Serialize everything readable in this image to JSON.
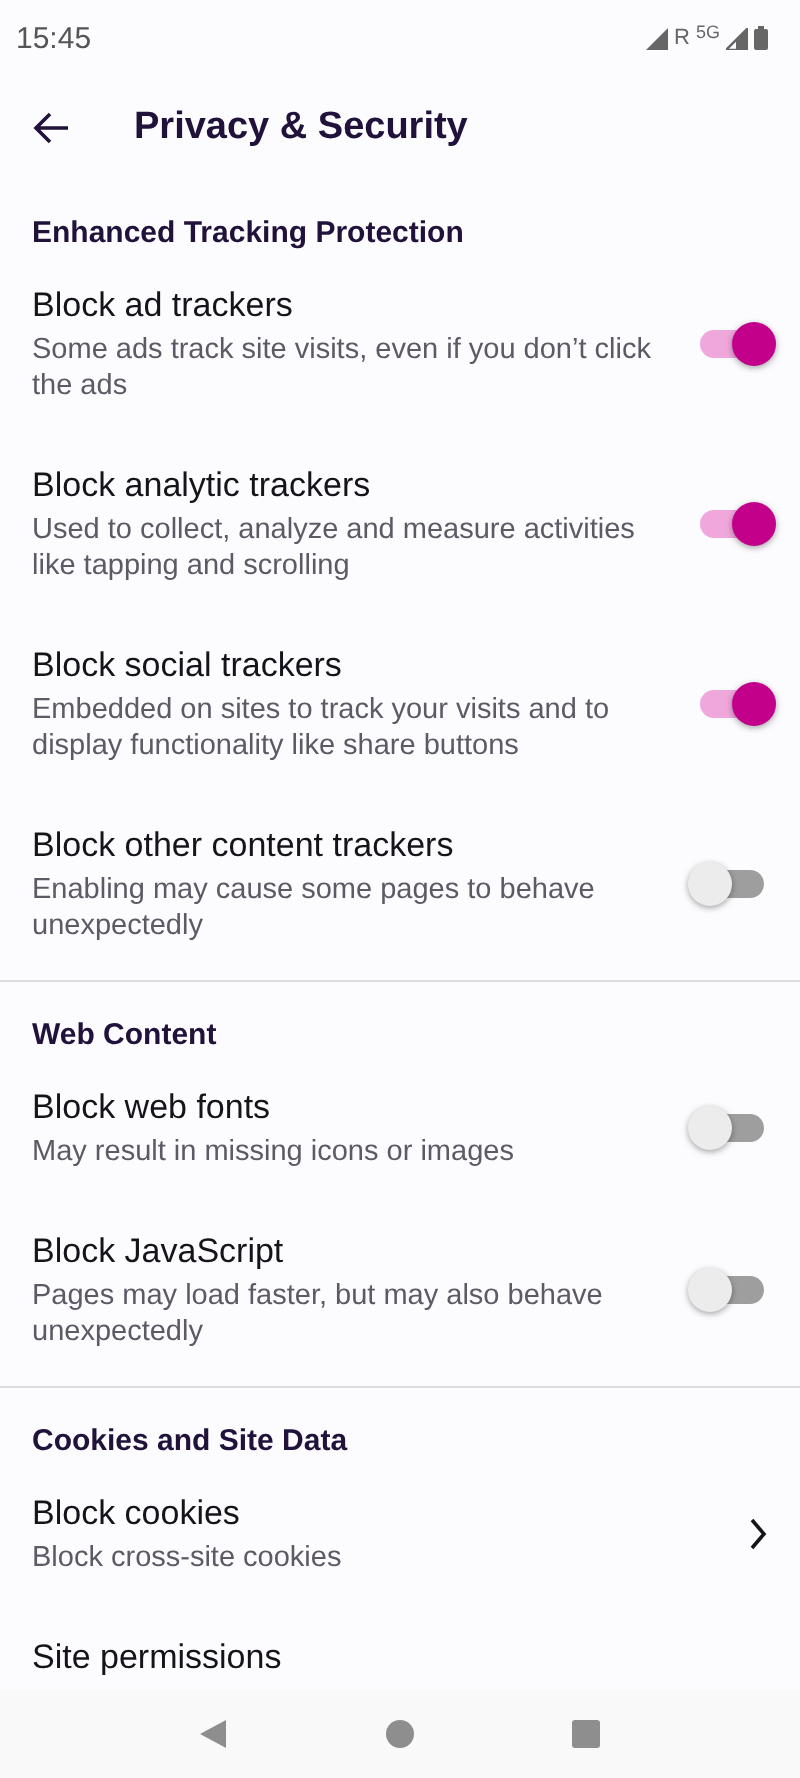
{
  "status_bar": {
    "time": "15:45",
    "roaming": "R",
    "network_type": "5G"
  },
  "app_bar": {
    "title": "Privacy & Security"
  },
  "sections": [
    {
      "title": "Enhanced Tracking Protection",
      "items": [
        {
          "kind": "switch",
          "title": "Block ad trackers",
          "subtitle": "Some ads track site visits, even if you don’t click the ads",
          "on": true
        },
        {
          "kind": "switch",
          "title": "Block analytic trackers",
          "subtitle": "Used to collect, analyze and measure activities like tapping and scrolling",
          "on": true
        },
        {
          "kind": "switch",
          "title": "Block social trackers",
          "subtitle": "Embedded on sites to track your visits and to display functionality like share buttons",
          "on": true
        },
        {
          "kind": "switch",
          "title": "Block other content trackers",
          "subtitle": "Enabling may cause some pages to behave unexpectedly",
          "on": false
        }
      ]
    },
    {
      "title": "Web Content",
      "items": [
        {
          "kind": "switch",
          "title": "Block web fonts",
          "subtitle": "May result in missing icons or images",
          "on": false
        },
        {
          "kind": "switch",
          "title": "Block JavaScript",
          "subtitle": "Pages may load faster, but may also behave unexpectedly",
          "on": false
        }
      ]
    },
    {
      "title": "Cookies and Site Data",
      "items": [
        {
          "kind": "link",
          "title": "Block cookies",
          "subtitle": "Block cross-site cookies"
        },
        {
          "kind": "plain",
          "title": "Site permissions"
        }
      ]
    }
  ]
}
